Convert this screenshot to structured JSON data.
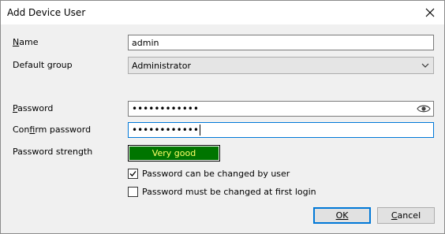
{
  "window": {
    "title": "Add Device User"
  },
  "form": {
    "name_label": "Name",
    "name_value": "admin",
    "group_label": "Default group",
    "group_value": "Administrator",
    "password_label": "Password",
    "password_value": "••••••••••••",
    "confirm_label": "Confirm password",
    "confirm_value": "••••••••••••",
    "strength_label": "Password strength",
    "strength_value": "Very good",
    "can_change_label": "Password can be changed by user",
    "can_change_checked": true,
    "must_change_label": "Password must be changed at first login",
    "must_change_checked": false
  },
  "buttons": {
    "ok": "OK",
    "cancel": "Cancel"
  },
  "icons": {
    "close": "close-icon",
    "dropdown": "chevron-down-icon",
    "reveal": "eye-icon",
    "check": "checkmark-icon"
  },
  "colors": {
    "strength_fill": "#007500",
    "strength_text": "#ffff66",
    "focus": "#0078d7"
  }
}
